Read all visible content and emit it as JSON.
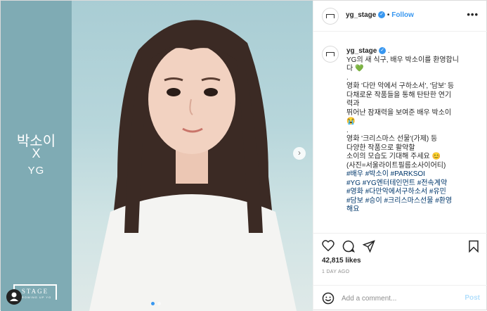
{
  "media": {
    "side_text_line1": "박소이",
    "side_text_line2": "X",
    "side_text_line3": "YG",
    "logo_text": "STAGE",
    "logo_subtext": "GROWING UP YG",
    "slide_count": 2,
    "active_slide": 1
  },
  "header": {
    "username": "yg_stage",
    "separator": "•",
    "follow_label": "Follow",
    "more_label": "•••"
  },
  "caption": {
    "username": "yg_stage",
    "lines": [
      "YG의 새 식구, 배우 박소이를 환영합니",
      "다 💚",
      ".",
      "영화 '다만 악에서 구하소서', '담보' 등",
      "다채로운 작품들을 통해 탄탄한 연기",
      "력과",
      "뛰어난 잠재력을 보여준 배우 박소이",
      "😭",
      ".",
      "영화 '크리스마스 선물'(가제) 등",
      "다양한 작품으로 활약할",
      "소이의 모습도 기대해 주세요 😊",
      "(사진=서울라이트필름소사이어티)"
    ],
    "hashtags": [
      "#배우 #박소이 #PARKSOI",
      "#YG #YG엔터테인먼트 #전속계약",
      "#영화 #다만악에서구하소서 #유민",
      "#담보 #승이 #크리스마스선물 #환영",
      "해요"
    ]
  },
  "likes": "42,815 likes",
  "date": "1 DAY AGO",
  "comment": {
    "placeholder": "Add a comment...",
    "post_label": "Post"
  },
  "colors": {
    "accent": "#3897f0",
    "verified": "#3897f0",
    "hashtag": "#00376b",
    "post_disabled": "#b2dffc",
    "side_panel": "#7fabb4"
  }
}
